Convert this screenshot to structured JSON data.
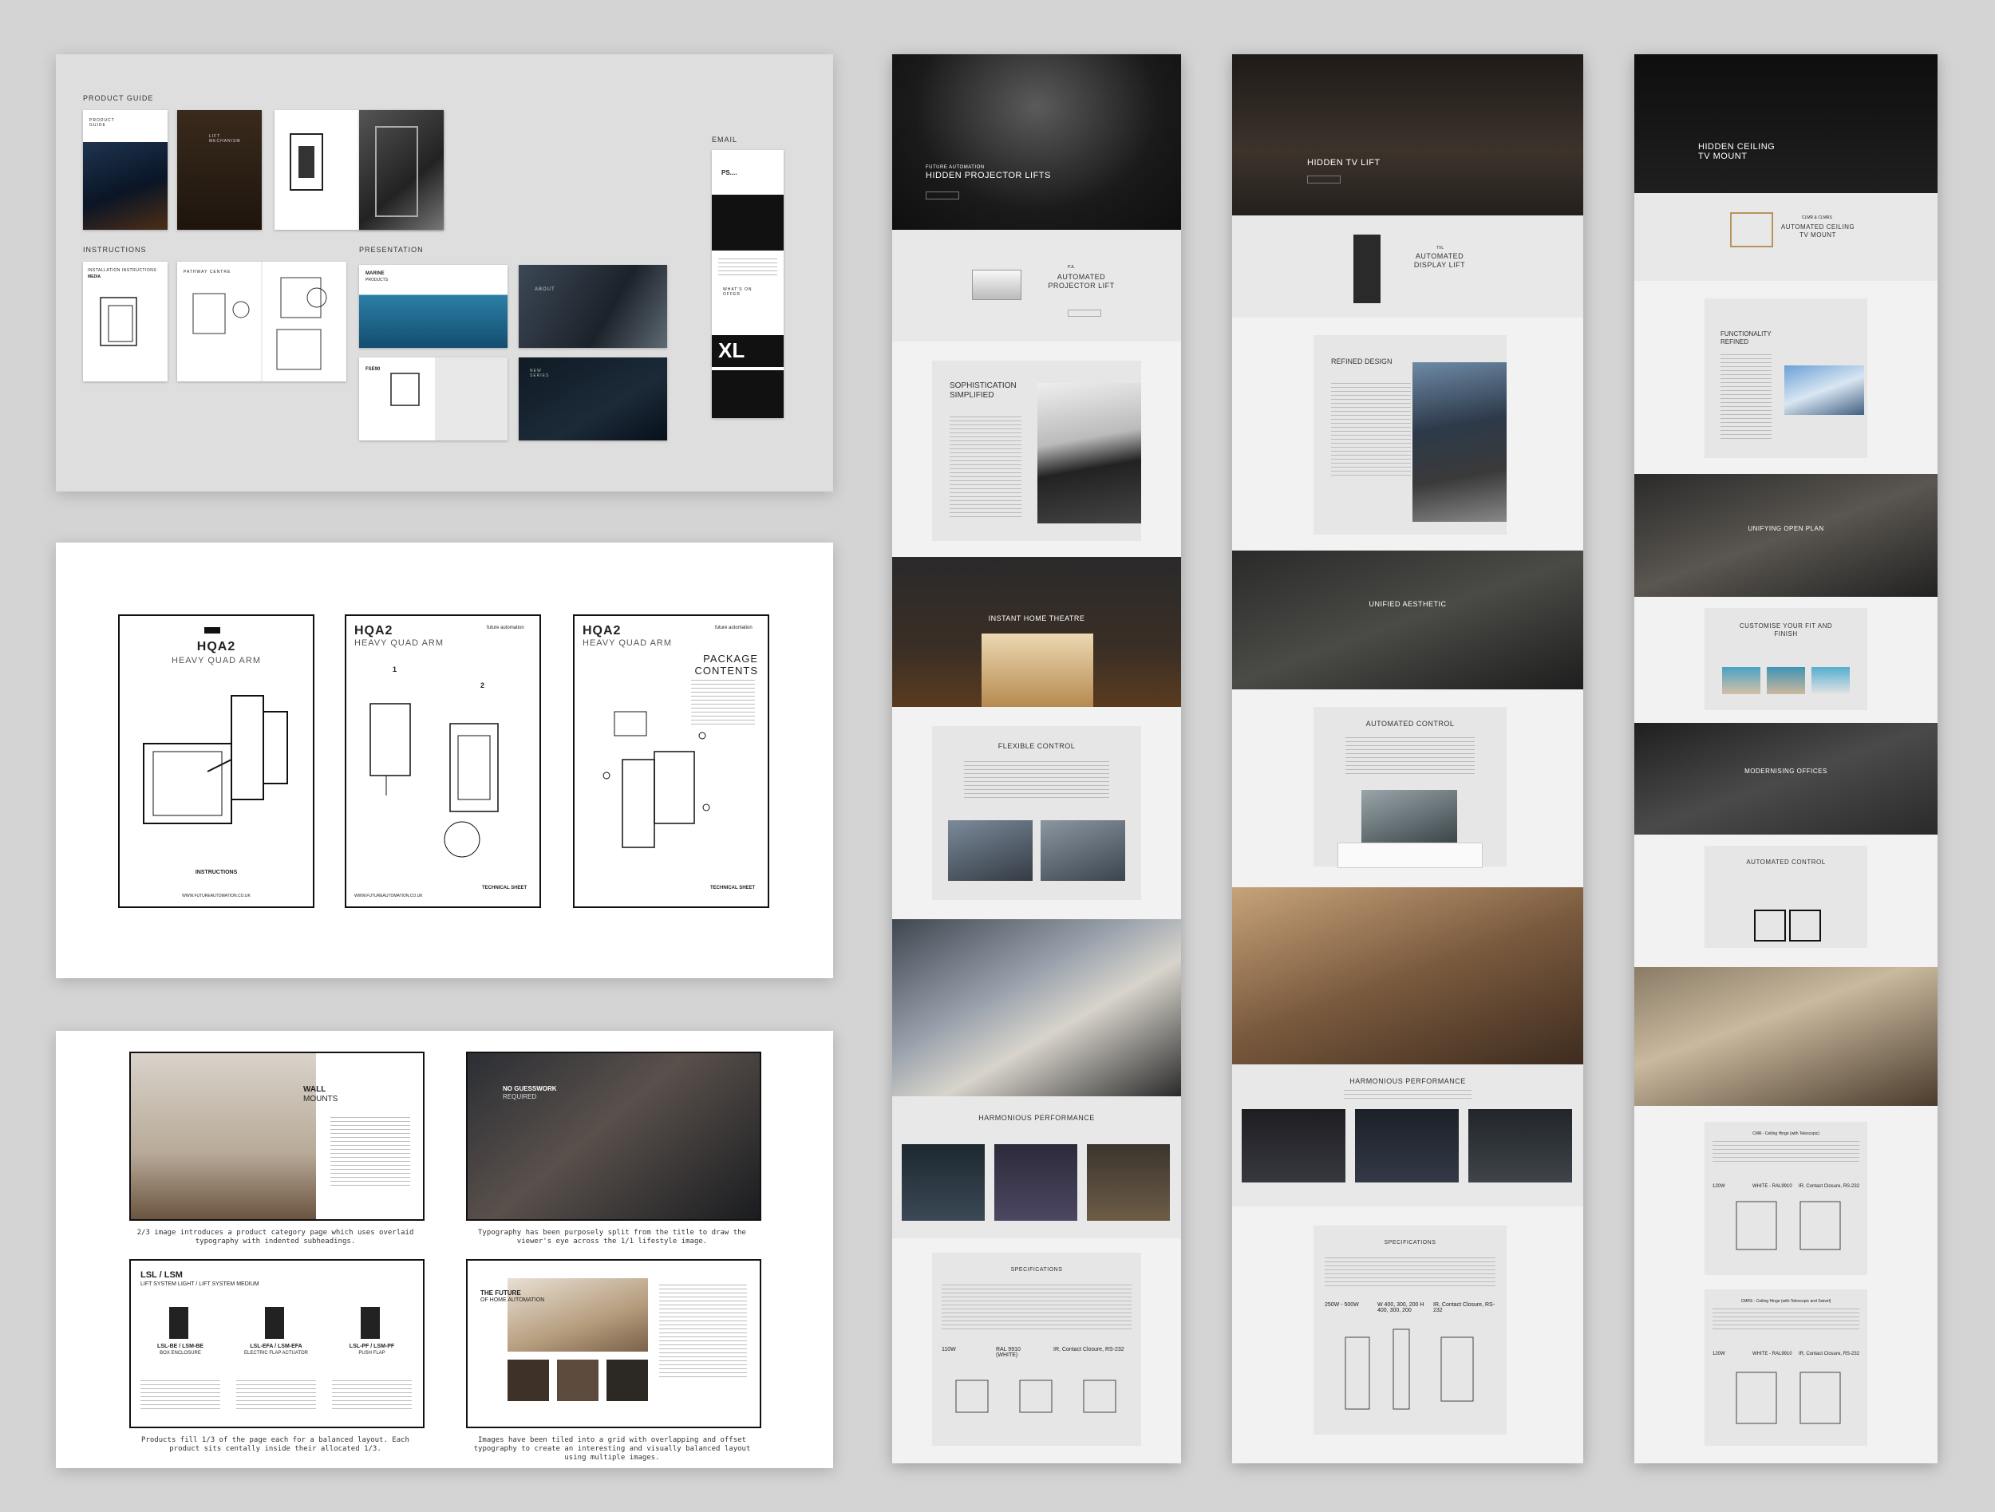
{
  "board1": {
    "product_guide_label": "PRODUCT GUIDE",
    "instructions_label": "INSTRUCTIONS",
    "presentation_label": "PRESENTATION",
    "email_label": "EMAIL",
    "guide_cover": "PRODUCT GUIDE",
    "lift_mechanism": "LIFT MECHANISM",
    "instr_title": "INSTALLATION INSTRUCTIONS",
    "instr_sub": "MEDIA",
    "instr_page2": "PATHWAY CENTRE",
    "marine_title": "MARINE",
    "marine_sub": "PRODUCTS",
    "about": "ABOUT",
    "fse90": "FSE90",
    "new_series": "NEW SERIES",
    "email_ps": "PS....",
    "email_what": "WHAT'S ON OFFER",
    "email_xl": "XL"
  },
  "board2": {
    "sheets": [
      {
        "title": "HQA2",
        "subtitle": "HEAVY QUAD ARM",
        "footer": "INSTRUCTIONS",
        "url": "WWW.FUTUREAUTOMATION.CO.UK"
      },
      {
        "title": "HQA2",
        "subtitle": "HEAVY QUAD ARM",
        "brand": "future automation",
        "step1": "1",
        "step2": "2",
        "footer": "TECHNICAL SHEET",
        "url": "WWW.FUTUREAUTOMATION.CO.UK"
      },
      {
        "title": "HQA2",
        "subtitle": "HEAVY QUAD ARM",
        "brand": "future automation",
        "heading": "PACKAGE CONTENTS",
        "footer": "TECHNICAL SHEET"
      }
    ]
  },
  "board3": {
    "wall": "WALL",
    "mounts": "MOUNTS",
    "no_guesswork": "NO GUESSWORK",
    "required": "REQUIRED",
    "cap1": "2/3 image introduces a product category page which uses overlaid typography with indented subheadings.",
    "cap2": "Typography has been purposely split from the title to draw the viewer's eye across the 1/1 lifestyle image.",
    "lsl_title": "LSL / LSM",
    "lsl_sub": "LIFT SYSTEM LIGHT / LIFT SYSTEM MEDIUM",
    "prod1": "LSL-BE / LSM-BE",
    "prod1_sub": "BOX ENCLOSURE",
    "prod2": "LSL-EFA / LSM-EFA",
    "prod2_sub": "ELECTRIC FLAP ACTUATOR",
    "prod3": "LSL-PF / LSM-PF",
    "prod3_sub": "PUSH FLAP",
    "future_title": "THE FUTURE",
    "future_sub": "OF HOME AUTOMATION",
    "cap3": "Products fill 1/3 of the page each for a balanced layout. Each product sits centally inside their allocated 1/3.",
    "cap4": "Images have been tiled into a grid with overlapping and offset typography to create an interesting and visually balanced layout using multiple images."
  },
  "site1": {
    "hero_kicker": "FUTURE AUTOMATION",
    "hero_title": "HIDDEN PROJECTOR LIFTS",
    "product_kicker": "PJL",
    "product_title": "AUTOMATED PROJECTOR LIFT",
    "soph": "SOPHISTICATION SIMPLIFIED",
    "theatre": "INSTANT HOME THEATRE",
    "flex": "FLEXIBLE CONTROL",
    "harmonious": "HARMONIOUS PERFORMANCE",
    "specs": "SPECIFICATIONS",
    "spec_a": "110W",
    "spec_b": "RAL 9910 (WHITE)",
    "spec_c": "IR, Contact Closure, RS-232"
  },
  "site2": {
    "hero_title": "HIDDEN TV LIFT",
    "product_kicker": "TVL",
    "product_title": "AUTOMATED DISPLAY LIFT",
    "refined": "REFINED DESIGN",
    "unified": "UNIFIED AESTHETIC",
    "control": "AUTOMATED CONTROL",
    "harmonious": "HARMONIOUS PERFORMANCE",
    "specs": "SPECIFICATIONS",
    "spec_a": "250W - 500W",
    "spec_b": "W 400, 300, 200 H 400, 300, 200",
    "spec_c": "IR, Contact Closure, RS-232"
  },
  "site3": {
    "hero_title": "HIDDEN CEILING TV MOUNT",
    "product_kicker": "CLMR & CLMRS",
    "product_title": "AUTOMATED CEILING TV MOUNT",
    "functionality": "FUNCTIONALITY REFINED",
    "open_plan": "UNIFYING OPEN PLAN",
    "customise": "CUSTOMISE YOUR FIT AND FINISH",
    "offices": "MODERNISING OFFICES",
    "control": "AUTOMATED CONTROL",
    "spec1_title": "CMR - Ceiling Hinge (with Telescopic)",
    "spec1_a": "120W",
    "spec1_b": "WHITE - RAL9910",
    "spec1_c": "IR, Contact Closure, RS-232",
    "spec2_title": "CMRS - Ceiling Hinge (with Telescopic and Swivel)",
    "spec2_a": "120W",
    "spec2_b": "WHITE - RAL9910",
    "spec2_c": "IR, Contact Closure, RS-232"
  }
}
